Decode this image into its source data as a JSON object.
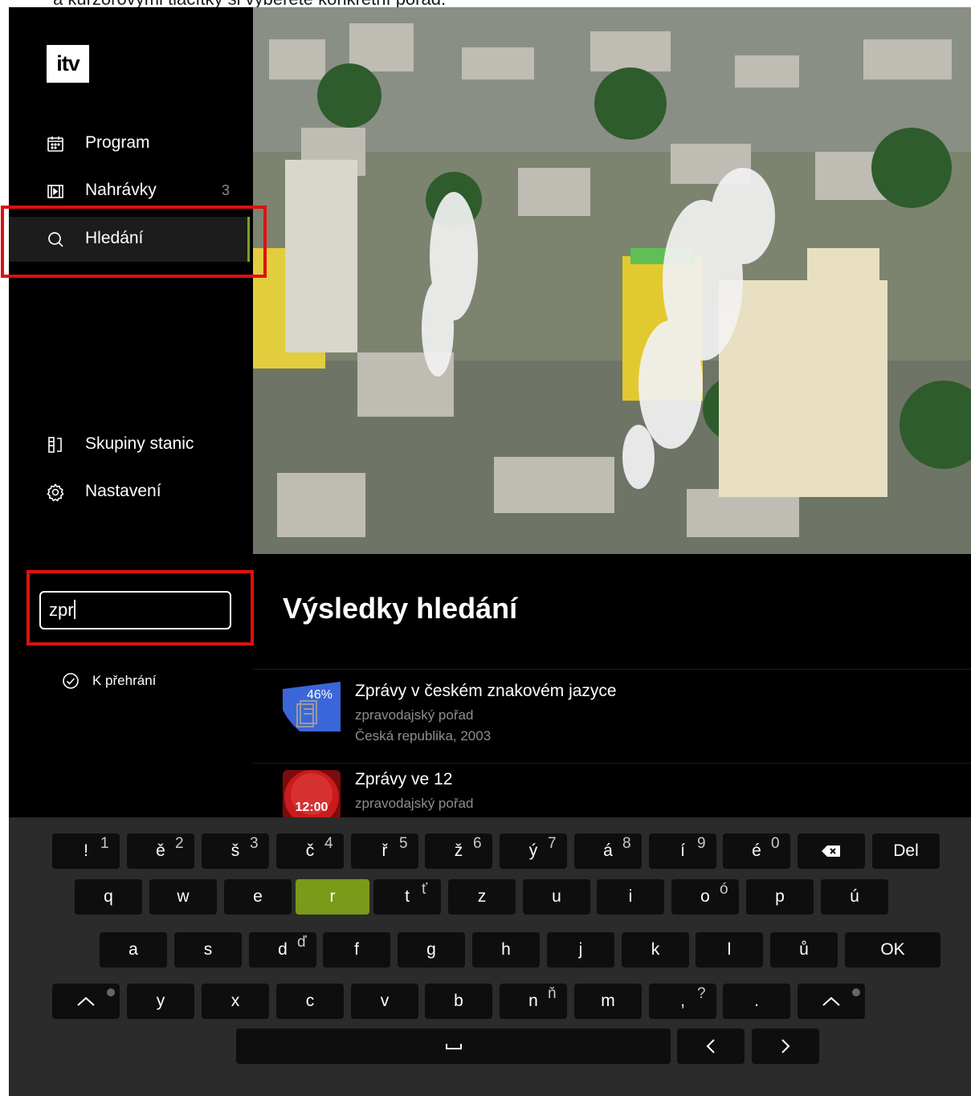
{
  "caption": "a kurzorovými tlačítky si vyberete konkrétní pořad.",
  "sidebar": {
    "logo": "itv",
    "nav_top": [
      {
        "label": "Program",
        "icon": "calendar-icon",
        "count": ""
      },
      {
        "label": "Nahrávky",
        "icon": "film-icon",
        "count": "3"
      },
      {
        "label": "Hledání",
        "icon": "search-icon",
        "count": ""
      }
    ],
    "nav_bottom": [
      {
        "label": "Skupiny stanic",
        "icon": "channel-groups-icon"
      },
      {
        "label": "Nastavení",
        "icon": "gear-icon"
      }
    ],
    "selected_index": 2
  },
  "search": {
    "value": "zpr",
    "filter_label": "K přehrání"
  },
  "results": {
    "heading": "Výsledky hledání",
    "items": [
      {
        "title": "Zprávy v českém znakovém jazyce",
        "genre": "zpravodajský pořad",
        "meta": "Česká republika, 2003",
        "badge": "46%",
        "progress": 0.46
      },
      {
        "title": "Zprávy ve 12",
        "genre": "zpravodajský pořad",
        "meta": "",
        "badge": "12:00"
      }
    ]
  },
  "keyboard": {
    "rows": [
      [
        "!",
        "ě",
        "š",
        "č",
        "ř",
        "ž",
        "ý",
        "á",
        "í",
        "é",
        "backspace",
        "Del"
      ],
      [
        "q",
        "w",
        "e",
        "r",
        "t",
        "z",
        "u",
        "i",
        "o",
        "p",
        "ú"
      ],
      [
        "a",
        "s",
        "d",
        "f",
        "g",
        "h",
        "j",
        "k",
        "l",
        "ů",
        "OK"
      ],
      [
        "shift",
        "y",
        "x",
        "c",
        "v",
        "b",
        "n",
        "m",
        ",",
        ".",
        "shift"
      ],
      [
        "space",
        "‹",
        "›"
      ]
    ],
    "alt_chars": {
      "!": "1",
      "ě": "2",
      "š": "3",
      "č": "4",
      "ř": "5",
      "ž": "6",
      "ý": "7",
      "á": "8",
      "í": "9",
      "é": "0",
      "t": "ť",
      "o": "ó",
      "d": "ď",
      "n": "ň",
      ",": "?"
    },
    "active_key": "r",
    "del_label": "Del",
    "ok_label": "OK"
  },
  "colors": {
    "accent": "#7aa51c",
    "highlight_box": "#e01010",
    "progress_blue": "#3a66d9"
  }
}
